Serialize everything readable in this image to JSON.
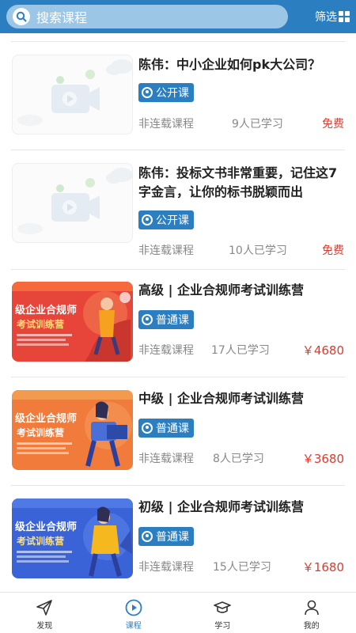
{
  "header": {
    "search_placeholder": "搜索课程",
    "filter_label": "筛选"
  },
  "courses": [
    {
      "title": "陈伟：中小企业如何pk大公司？",
      "tag": "公开课",
      "type": "非连载课程",
      "learners": "9人已学习",
      "price": "免费",
      "thumb": "placeholder"
    },
    {
      "title": "陈伟：投标文书非常重要，记住这7字金言，让你的标书脱颖而出",
      "tag": "公开课",
      "type": "非连载课程",
      "learners": "10人已学习",
      "price": "免费",
      "thumb": "placeholder"
    },
    {
      "title": "高级 | 企业合规师考试训练营",
      "tag": "普通课",
      "type": "非连载课程",
      "learners": "17人已学习",
      "price": "￥4680",
      "thumb": "red-banner",
      "thumb_text": "级企业合规师考试训练营"
    },
    {
      "title": "中级 | 企业合规师考试训练营",
      "tag": "普通课",
      "type": "非连载课程",
      "learners": "8人已学习",
      "price": "￥3680",
      "thumb": "orange-banner",
      "thumb_text": "级企业合规师考试训练营"
    },
    {
      "title": "初级 | 企业合规师考试训练营",
      "tag": "普通课",
      "type": "非连载课程",
      "learners": "15人已学习",
      "price": "￥1680",
      "thumb": "blue-banner",
      "thumb_text": "级企业合规师考试训练营"
    }
  ],
  "tabbar": [
    {
      "label": "发现",
      "icon": "paper-plane-icon",
      "active": false
    },
    {
      "label": "课程",
      "icon": "play-circle-icon",
      "active": true
    },
    {
      "label": "学习",
      "icon": "graduation-cap-icon",
      "active": false
    },
    {
      "label": "我的",
      "icon": "person-icon",
      "active": false
    }
  ],
  "colors": {
    "brand": "#2b7fc1",
    "price": "#e03a2f"
  }
}
